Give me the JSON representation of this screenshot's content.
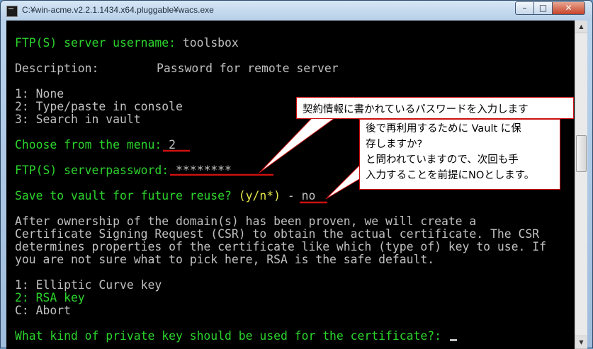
{
  "window": {
    "title": "C:¥win-acme.v2.2.1.1434.x64.pluggable¥wacs.exe",
    "controls": {
      "minimize": "–",
      "maximize": "□",
      "close": "✕"
    }
  },
  "console": {
    "line1_label": "FTP(S) server username: ",
    "line1_value": "toolsbox",
    "line2_label": "Description:",
    "line2_value": "Password for remote server",
    "menu1": [
      "1: None",
      "2: Type/paste in console",
      "3: Search in vault"
    ],
    "choose_label": "Choose from the menu: ",
    "choose_value": "2",
    "password_label": "FTP(S) serverpassword: ",
    "password_value": "********",
    "save_label": "Save to vault for future reuse? ",
    "save_options": "(y/n*)",
    "save_sep": " - ",
    "save_value": "no",
    "info": [
      "After ownership of the domain(s) has been proven, we will create a",
      "Certificate Signing Request (CSR) to obtain the actual certificate. The CSR",
      "determines properties of the certificate like which (type of) key to use. If",
      "you are not sure what to pick here, RSA is the safe default."
    ],
    "menu2": [
      "1: Elliptic Curve key",
      "2: RSA key",
      "C: Abort"
    ],
    "prompt": "What kind of private key should be used for the certificate?: "
  },
  "annotations": {
    "callout1": "契約情報に書かれているパスワードを入力します",
    "callout2": "後で再利用するために Vault に保\n存しますか?\nと問われていますので、次回も手\n入力することを前提にNOとします。",
    "color": "#cc1010"
  }
}
